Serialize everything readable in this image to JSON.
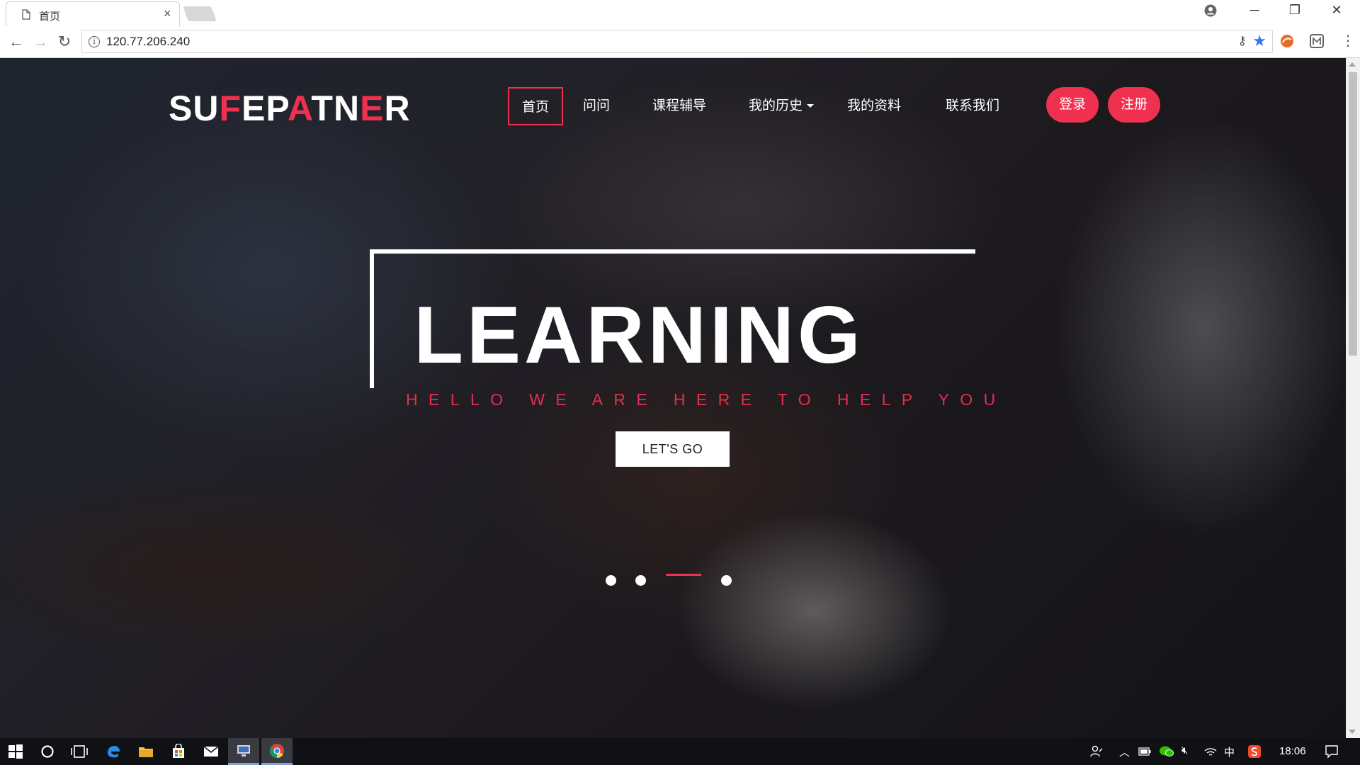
{
  "browser": {
    "tab_title": "首页",
    "tab_close": "×",
    "url": "120.77.206.240",
    "info_glyph": "i",
    "back_glyph": "←",
    "forward_glyph": "→",
    "reload_glyph": "↻",
    "key_glyph": "⚷",
    "star_glyph": "★",
    "menu_glyph": "⋮",
    "minimize_glyph": "─",
    "restore_glyph": "❐",
    "close_glyph": "✕"
  },
  "site": {
    "brand_parts": [
      "SU",
      "F",
      "EP",
      "A",
      "TN",
      "E",
      "R"
    ],
    "nav": [
      "首页",
      "问问",
      "课程辅导",
      "我的历史",
      "我的资料",
      "联系我们"
    ],
    "login_label": "登录",
    "register_label": "注册"
  },
  "hero": {
    "title": "LEARNING",
    "subtitle": "HELLO WE ARE HERE TO HELP YOU",
    "cta_label": "LET'S GO",
    "slides_total": 4,
    "active_slide": 3
  },
  "taskbar": {
    "clock": "18:06",
    "ime": "中"
  },
  "colors": {
    "accent": "#f0304f",
    "hero_text": "#ffffff",
    "subtitle": "#e0304c"
  }
}
